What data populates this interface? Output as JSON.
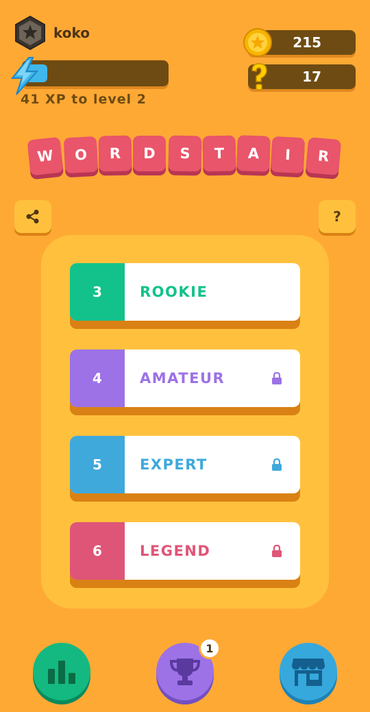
{
  "profile": {
    "username": "koko",
    "xp_text": "41 XP to level 2",
    "xp_progress": 0.16,
    "avatar_icon": "star-badge-icon",
    "xp_icon": "lightning-bolt-icon"
  },
  "currency": {
    "coins": "215",
    "hints": "17",
    "coin_icon": "coin-star-icon",
    "hint_icon": "question-mark-icon"
  },
  "title_letters": [
    "W",
    "O",
    "R",
    "D",
    "S",
    "T",
    "A",
    "I",
    "R"
  ],
  "buttons": {
    "share_icon": "share-icon",
    "help_label": "?"
  },
  "levels": [
    {
      "number": "3",
      "name": "ROOKIE",
      "color": "#12c28a",
      "locked": false
    },
    {
      "number": "4",
      "name": "AMATEUR",
      "color": "#9c72e6",
      "locked": true
    },
    {
      "number": "5",
      "name": "EXPERT",
      "color": "#3fa9dc",
      "locked": true
    },
    {
      "number": "6",
      "name": "LEGEND",
      "color": "#df5577",
      "locked": true
    }
  ],
  "nav": {
    "stats_icon": "bar-chart-icon",
    "trophy_icon": "trophy-icon",
    "shop_icon": "store-icon",
    "trophy_badge": "1",
    "stats_color": "#13b980",
    "trophy_color": "#9c72e6",
    "shop_color": "#36a8dc"
  },
  "colors": {
    "background": "#ffa935",
    "panel": "#ffc13d",
    "tile": "#e9556a",
    "pill": "#6e4b12"
  }
}
